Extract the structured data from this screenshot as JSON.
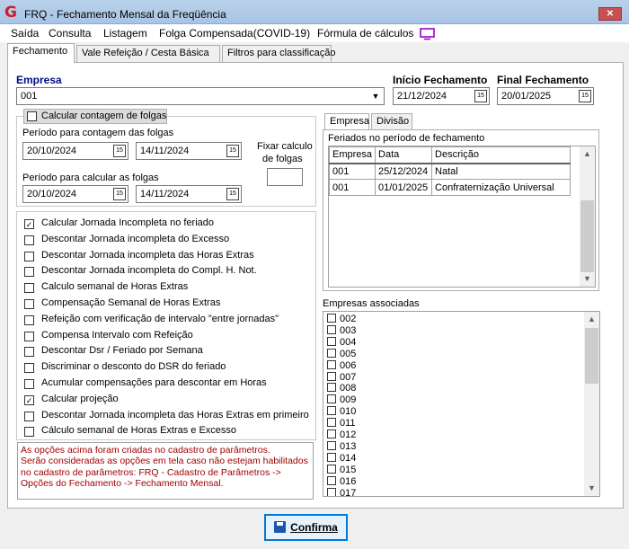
{
  "window": {
    "title": "FRQ - Fechamento Mensal da Freqüência",
    "logo": "G",
    "close": "✕"
  },
  "menu": [
    {
      "label": "Saída"
    },
    {
      "label": "Consulta"
    },
    {
      "label": "Listagem"
    },
    {
      "label": "Folga Compensada(COVID-19)"
    },
    {
      "label": "Fórmula de cálculos"
    }
  ],
  "tabs": [
    "Fechamento",
    "Vale Refeição / Cesta Básica",
    "Filtros para classificação"
  ],
  "empresa": {
    "label": "Empresa",
    "value": "001"
  },
  "inicio": {
    "label": "Início Fechamento",
    "value": "21/12/2024"
  },
  "final": {
    "label": "Final Fechamento",
    "value": "20/01/2025"
  },
  "folgas": {
    "checkbox_label": "Calcular contagem de folgas",
    "periodo_contagem_label": "Período para contagem das folgas",
    "contagem_de": "20/10/2024",
    "contagem_ate": "14/11/2024",
    "periodo_calcular_label": "Período para calcular as folgas",
    "calcular_de": "20/10/2024",
    "calcular_ate": "14/11/2024",
    "fixar_label_1": "Fixar calculo",
    "fixar_label_2": "de folgas",
    "fixar_value": ""
  },
  "options": [
    {
      "label": "Calcular Jornada Incompleta no feriado",
      "checked": true
    },
    {
      "label": "Descontar Jornada incompleta do Excesso",
      "checked": false
    },
    {
      "label": "Descontar Jornada incompleta das Horas Extras",
      "checked": false
    },
    {
      "label": "Descontar Jornada incompleta do Compl. H. Not.",
      "checked": false
    },
    {
      "label": "Calculo semanal de Horas Extras",
      "checked": false
    },
    {
      "label": "Compensação Semanal de Horas Extras",
      "checked": false
    },
    {
      "label": "Refeição com verificação de intervalo  \"entre jornadas\"",
      "checked": false
    },
    {
      "label": "Compensa Intervalo com Refeição",
      "checked": false
    },
    {
      "label": "Descontar Dsr / Feriado por Semana",
      "checked": false
    },
    {
      "label": "Discriminar o desconto do DSR do feriado",
      "checked": false
    },
    {
      "label": "Acumular compensações para descontar em Horas",
      "checked": false
    },
    {
      "label": "Calcular projeção",
      "checked": true
    },
    {
      "label": "Descontar Jornada incompleta das Horas Extras em primeiro",
      "checked": false
    },
    {
      "label": "Cálculo semanal de Horas Extras e Excesso",
      "checked": false
    }
  ],
  "notes": [
    "As opções acima foram criadas no cadastro de parâmetros.",
    "Serão consideradas as opções em tela caso não estejam habilitados",
    "no cadastro de parâmetros: FRQ - Cadastro de Parâmetros ->",
    "Opções do Fechamento -> Fechamento Mensal."
  ],
  "subtabs": [
    "Empresa",
    "Divisão"
  ],
  "feriados": {
    "title": "Feriados no período de fechamento",
    "headers": [
      "Empresa",
      "Data",
      "Descrição"
    ],
    "rows": [
      [
        "001",
        "25/12/2024",
        "Natal"
      ],
      [
        "001",
        "01/01/2025",
        "Confraternização Universal"
      ]
    ]
  },
  "associadas": {
    "title": "Empresas associadas",
    "items": [
      "002",
      "003",
      "004",
      "005",
      "006",
      "007",
      "008",
      "009",
      "010",
      "011",
      "012",
      "013",
      "014",
      "015",
      "016",
      "017"
    ]
  },
  "confirm": {
    "label": "Confirma"
  },
  "colors": {
    "notes_text": "#a00000",
    "label_blue": "#000a8a",
    "title_bar": "#b9d1ea",
    "monitor_icon": "#a000c8"
  },
  "icons": {
    "calendar": "calendar-icon",
    "dropdown": "chevron-down-icon",
    "save": "floppy-icon",
    "monitor": "monitor-icon",
    "checkmark": "✓",
    "scroll_up": "▲",
    "scroll_down": "▼"
  }
}
